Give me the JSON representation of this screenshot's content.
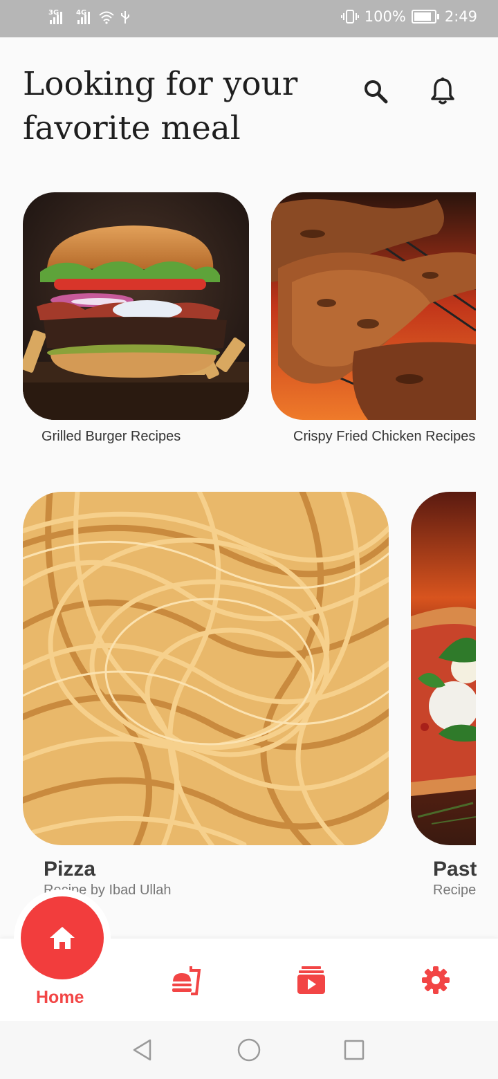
{
  "status_bar": {
    "network1": "3G",
    "network2": "4G",
    "battery": "100%",
    "battery_level": 1.0,
    "time": "2:49",
    "icons": [
      "signal-icon",
      "wifi-icon",
      "usb-icon",
      "vibrate-icon",
      "battery-icon"
    ]
  },
  "header": {
    "title": "Looking for your favorite meal",
    "icons": [
      "search-icon",
      "bell-icon"
    ]
  },
  "small_cards": [
    {
      "caption": "Grilled Burger Recipes",
      "image": "burger"
    },
    {
      "caption": "Crispy Fried Chicken Recipes",
      "image": "grilled-chicken"
    }
  ],
  "big_cards": [
    {
      "title": "Pizza",
      "subtitle": "Recipe by Ibad Ullah",
      "image": "pasta"
    },
    {
      "title": "Past",
      "subtitle": "Recipe",
      "image": "pizza"
    }
  ],
  "bottom_nav": {
    "active_label": "Home",
    "items": [
      "home-icon",
      "fast-food-icon",
      "video-subscriptions-icon",
      "settings-icon"
    ],
    "accent": "#f23d3d"
  },
  "system_nav": {
    "items": [
      "back-icon",
      "home-circle-icon",
      "recents-icon"
    ]
  }
}
